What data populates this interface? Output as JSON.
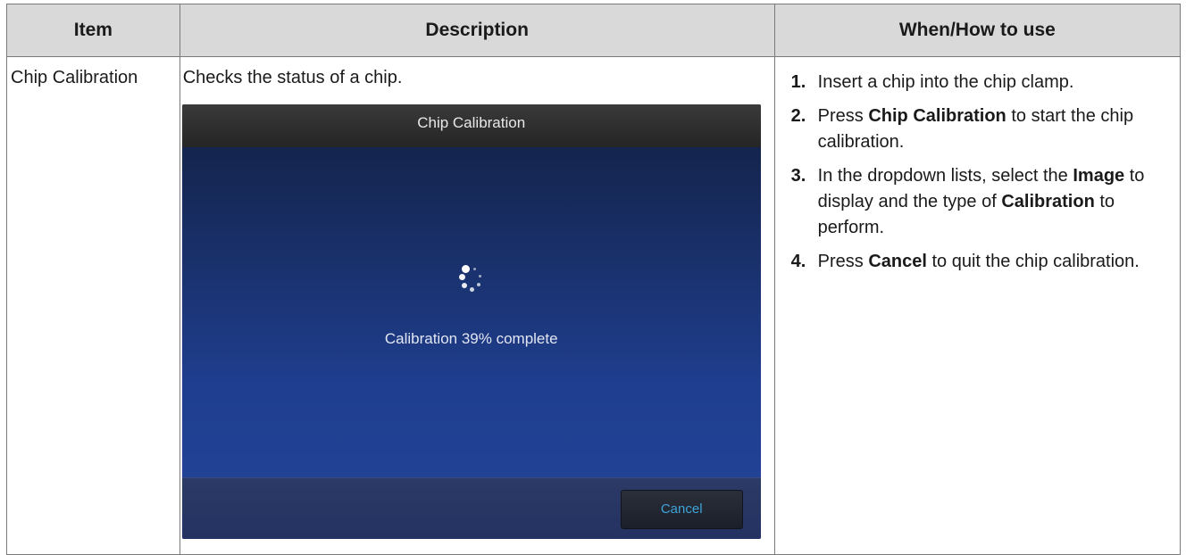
{
  "table": {
    "headers": {
      "item": "Item",
      "description": "Description",
      "when_how": "When/How to use"
    },
    "row": {
      "item": "Chip Calibration",
      "description": "Checks the status of a chip.",
      "screen": {
        "title": "Chip Calibration",
        "progress_text": "Calibration 39% complete",
        "progress_percent": 39,
        "cancel_label": "Cancel",
        "spinner_icon": "loading-spinner-icon"
      },
      "steps": [
        {
          "num": "1.",
          "parts": [
            {
              "t": "Insert a chip into the chip clamp."
            }
          ]
        },
        {
          "num": "2.",
          "parts": [
            {
              "t": "Press "
            },
            {
              "t": "Chip Calibration",
              "kw": true
            },
            {
              "t": " to start the chip calibration."
            }
          ]
        },
        {
          "num": "3.",
          "parts": [
            {
              "t": "In the dropdown lists, select the "
            },
            {
              "t": "Image",
              "kw": true
            },
            {
              "t": " to display and the type of "
            },
            {
              "t": "Calibration",
              "kw": true
            },
            {
              "t": " to perform."
            }
          ]
        },
        {
          "num": "4.",
          "parts": [
            {
              "t": "Press "
            },
            {
              "t": "Cancel",
              "kw": true
            },
            {
              "t": " to quit the chip calibration."
            }
          ]
        }
      ]
    }
  },
  "colors": {
    "header_bg": "#d9d9d9",
    "screen_accent": "#3fa3d8"
  }
}
